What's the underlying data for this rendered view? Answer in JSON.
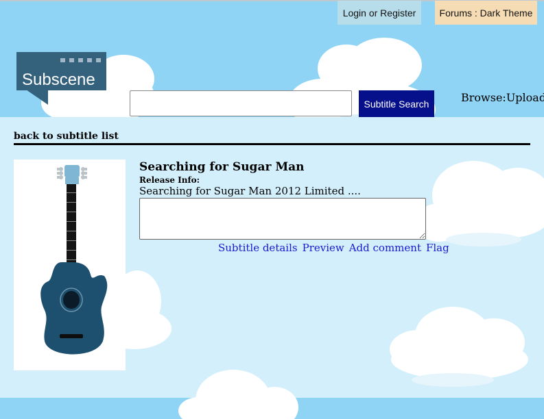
{
  "header": {
    "login_label": "Login or Register",
    "forums_label": "Forums : Dark Theme",
    "logo_text": "Subscene",
    "search_button_label": "Subtitle Search",
    "search_placeholder": "",
    "browse_label": "Browse",
    "separator": ":",
    "upload_label": "Upload"
  },
  "nav": {
    "back_label": "back to subtitle list"
  },
  "subtitle": {
    "title": "Searching for Sugar Man",
    "release_info_label": "Release Info:",
    "release_info": "Searching for Sugar Man 2012 Limited ....",
    "comment_value": "",
    "poster_icon": "acoustic-guitar-icon"
  },
  "actions": {
    "details_label": "Subtitle details",
    "preview_label": "Preview",
    "comment_label": "Add comment",
    "flag_label": "Flag"
  },
  "colors": {
    "sky": "#8fd4f5",
    "content_background": "#d3effb",
    "login_button": "#b7dcea",
    "forums_button": "#f5dcb4",
    "search_button": "#06108a",
    "link": "#1a1ad0",
    "logo": "#34627d"
  }
}
